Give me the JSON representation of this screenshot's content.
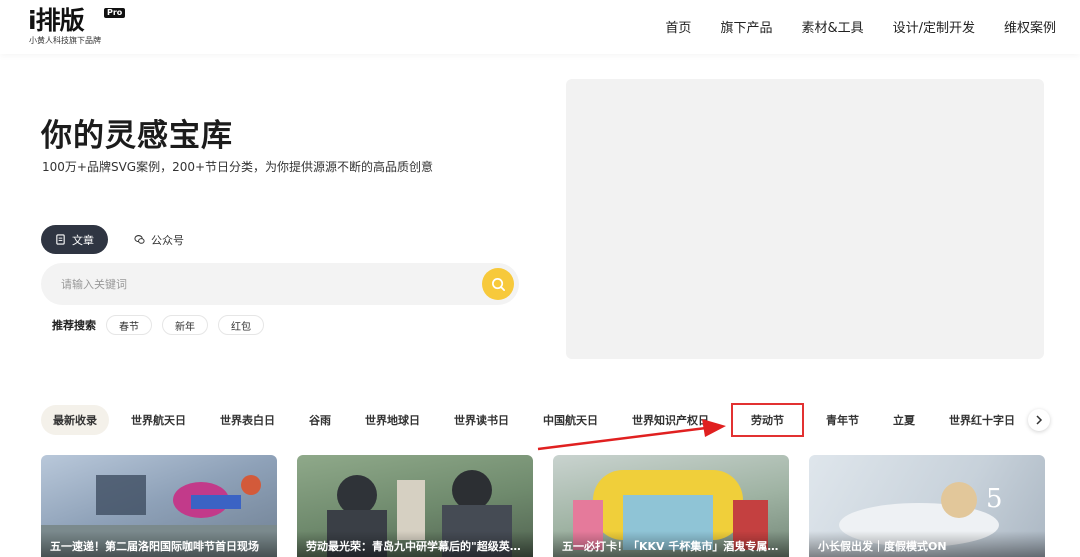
{
  "logo": {
    "main": "i排版",
    "badge": "Pro",
    "tagline": "小黄人科技旗下品牌"
  },
  "nav": [
    "首页",
    "旗下产品",
    "素材&工具",
    "设计/定制开发",
    "维权案例"
  ],
  "hero": {
    "title": "你的灵感宝库",
    "subtitle": "100万+品牌SVG案例，200+节日分类，为你提供源源不断的高品质创意"
  },
  "tabs": [
    {
      "label": "文章",
      "icon": "document-icon",
      "active": true
    },
    {
      "label": "公众号",
      "icon": "wechat-icon",
      "active": false
    }
  ],
  "search": {
    "placeholder": "请输入关键词",
    "value": ""
  },
  "hot_search": {
    "label": "推荐搜索",
    "tags": [
      "春节",
      "新年",
      "红包"
    ]
  },
  "categories": [
    "最新收录",
    "世界航天日",
    "世界表白日",
    "谷雨",
    "世界地球日",
    "世界读书日",
    "中国航天日",
    "世界知识产权日",
    "劳动节",
    "青年节",
    "立夏",
    "世界红十字日"
  ],
  "highlighted_category": "劳动节",
  "cards": [
    {
      "caption": "五一速递！第二届洛阳国际咖啡节首日现场"
    },
    {
      "caption": "劳动最光荣：青岛九中研学幕后的\"超级英雄\""
    },
    {
      "caption": "五一必打卡！「KKV 千杯集市」酒鬼专属狂欢"
    },
    {
      "caption": "小长假出发｜度假模式ON"
    }
  ],
  "colors": {
    "accent_yellow": "#f7c93b",
    "tab_active": "#2f3542",
    "highlight_red": "#e23131"
  }
}
